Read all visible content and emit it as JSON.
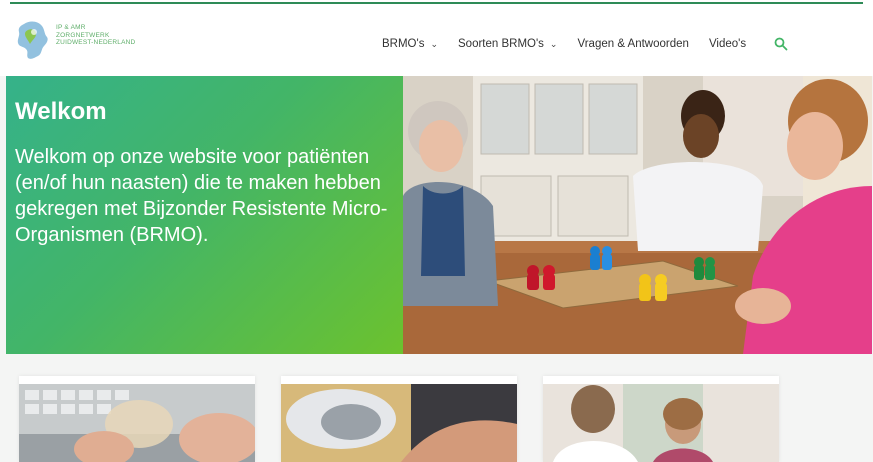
{
  "logo": {
    "line1": "IP & AMR",
    "line2": "ZORGNETWERK",
    "line3": "ZUIDWEST-NEDERLAND"
  },
  "nav": {
    "items": [
      {
        "label": "BRMO's",
        "dropdown": true
      },
      {
        "label": "Soorten BRMO's",
        "dropdown": true
      },
      {
        "label": "Vragen & Antwoorden",
        "dropdown": false
      },
      {
        "label": "Video's",
        "dropdown": false
      }
    ],
    "search_icon": "search-icon"
  },
  "hero": {
    "title": "Welkom",
    "text": "Welkom op onze website voor patiënten (en/of hun naasten) die te maken hebben gekregen met Bijzonder Resistente Micro-Organismen (BRMO)."
  },
  "colors": {
    "brand_green": "#43b567",
    "accent_green": "#2e8b57",
    "gradient_start": "#35b28a",
    "gradient_end": "#6cc22e"
  },
  "cards": [
    {
      "image": "keyboard-hands-photo"
    },
    {
      "image": "medical-device-photo"
    },
    {
      "image": "nurse-consultation-photo"
    }
  ]
}
